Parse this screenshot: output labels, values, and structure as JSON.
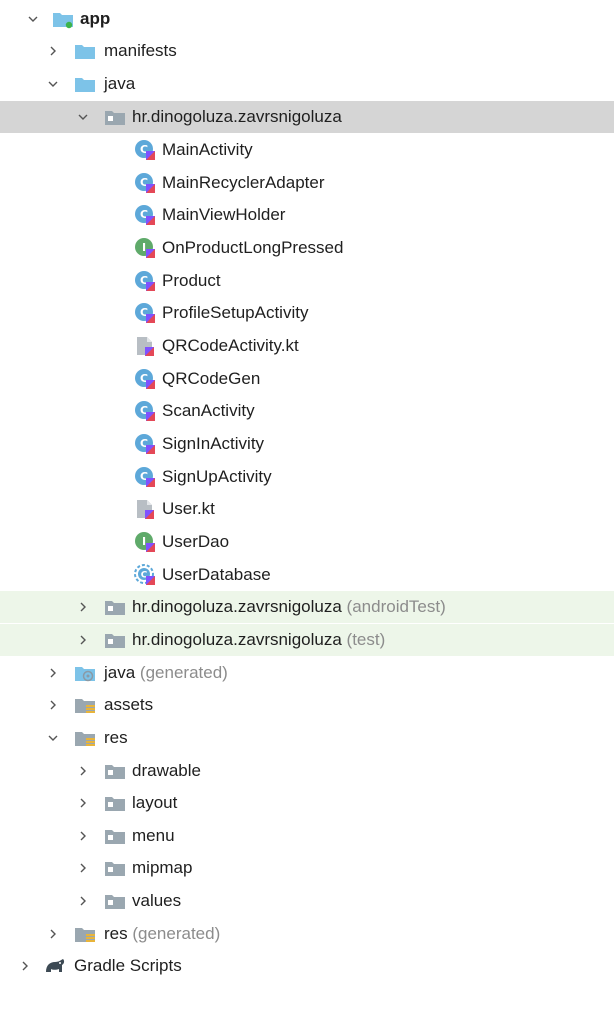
{
  "tree": {
    "root": {
      "label": "app"
    },
    "manifests": {
      "label": "manifests"
    },
    "java": {
      "label": "java"
    },
    "package_main": {
      "label": "hr.dinogoluza.zavrsnigoluza"
    },
    "files": [
      {
        "label": "MainActivity",
        "icon": "kotlin-class-icon"
      },
      {
        "label": "MainRecyclerAdapter",
        "icon": "kotlin-class-icon"
      },
      {
        "label": "MainViewHolder",
        "icon": "kotlin-class-icon"
      },
      {
        "label": "OnProductLongPressed",
        "icon": "kotlin-interface-icon"
      },
      {
        "label": "Product",
        "icon": "kotlin-class-icon"
      },
      {
        "label": "ProfileSetupActivity",
        "icon": "kotlin-class-icon"
      },
      {
        "label": "QRCodeActivity.kt",
        "icon": "kotlin-file-icon"
      },
      {
        "label": "QRCodeGen",
        "icon": "kotlin-class-icon"
      },
      {
        "label": "ScanActivity",
        "icon": "kotlin-class-icon"
      },
      {
        "label": "SignInActivity",
        "icon": "kotlin-class-icon"
      },
      {
        "label": "SignUpActivity",
        "icon": "kotlin-class-icon"
      },
      {
        "label": "User.kt",
        "icon": "kotlin-file-icon"
      },
      {
        "label": "UserDao",
        "icon": "kotlin-interface-icon"
      },
      {
        "label": "UserDatabase",
        "icon": "kotlin-abstract-class-icon"
      }
    ],
    "package_android_test": {
      "label": "hr.dinogoluza.zavrsnigoluza",
      "suffix": "(androidTest)"
    },
    "package_test": {
      "label": "hr.dinogoluza.zavrsnigoluza",
      "suffix": "(test)"
    },
    "java_generated": {
      "label": "java",
      "suffix": "(generated)"
    },
    "assets": {
      "label": "assets"
    },
    "res": {
      "label": "res"
    },
    "res_children": [
      {
        "label": "drawable"
      },
      {
        "label": "layout"
      },
      {
        "label": "menu"
      },
      {
        "label": "mipmap"
      },
      {
        "label": "values"
      }
    ],
    "res_generated": {
      "label": "res",
      "suffix": "(generated)"
    },
    "gradle_scripts": {
      "label": "Gradle Scripts"
    }
  },
  "colors": {
    "selected_row": "#d5d5d5",
    "test_package_row": "#edf6e9",
    "folder_blue": "#7dc3e8",
    "package_gray": "#9aa7b0",
    "kotlin_class": "#5da8d9",
    "kotlin_interface": "#5faa6a",
    "suffix_text": "#8c8c8c"
  }
}
